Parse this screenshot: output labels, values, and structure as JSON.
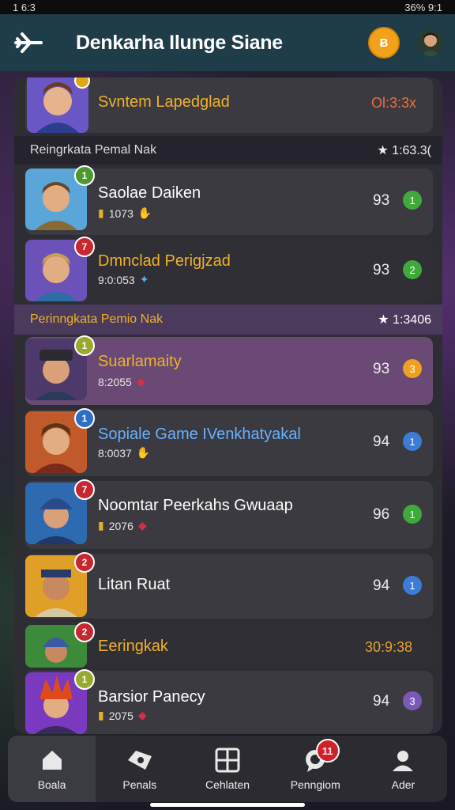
{
  "status": {
    "left": "1 6:3",
    "right": "36% 9:1"
  },
  "header": {
    "title": "Denkarha Ilunge Siane",
    "coin_label": "Ƀ"
  },
  "top_row": {
    "name": "Svntem Lapedglad",
    "time": "Ol:3:3x"
  },
  "section1": {
    "label": "Reingrkata Pemal Nak",
    "value": "★ 1:63.3("
  },
  "section2": {
    "label": "Perinngkata Pemio Nak",
    "value": "★ 1:3406"
  },
  "rows": [
    {
      "name": "Saolae Daiken",
      "sub": "1073",
      "score": "93",
      "rank": "1",
      "rank_color": "#3fa93a",
      "badge": "1",
      "badge_color": "#4a9a2e",
      "name_color": "#ffffff"
    },
    {
      "name": "Dmnclad Perigjzad",
      "sub": "9:0:053",
      "score": "93",
      "rank": "2",
      "rank_color": "#3fa93a",
      "badge": "7",
      "badge_color": "#c7282f",
      "name_color": "#f0b12a"
    },
    {
      "name": "Suarlamaity",
      "sub": "8:2055",
      "score": "93",
      "rank": "3",
      "rank_color": "#f0a020",
      "badge": "1",
      "badge_color": "#9aa92e",
      "name_color": "#f0b12a"
    },
    {
      "name": "Sopiale Game IVenkhatyakal",
      "sub": "8:0037",
      "score": "94",
      "rank": "1",
      "rank_color": "#3c7bd8",
      "badge": "1",
      "badge_color": "#2e6ec7",
      "name_color": "#66b2ff"
    },
    {
      "name": "Noomtar Peerkahs Gwuaap",
      "sub": "2076",
      "score": "96",
      "rank": "1",
      "rank_color": "#3fa93a",
      "badge": "7",
      "badge_color": "#c7282f",
      "name_color": "#ffffff"
    },
    {
      "name": "Litan Ruat",
      "sub": "",
      "score": "94",
      "rank": "1",
      "rank_color": "#3c7bd8",
      "badge": "2",
      "badge_color": "#c7282f",
      "name_color": "#ffffff"
    }
  ],
  "row_eringkak": {
    "name": "Eeringkak",
    "time": "30:9:38",
    "badge": "2"
  },
  "row_last": {
    "name": "Barsior Panecy",
    "sub": "2075",
    "score": "94",
    "rank": "3",
    "badge": "1"
  },
  "tabs": [
    {
      "label": "Boala"
    },
    {
      "label": "Penals"
    },
    {
      "label": "Cehlaten"
    },
    {
      "label": "Penngiom",
      "badge": "11"
    },
    {
      "label": "Ader"
    }
  ],
  "colors": {
    "header_bg": "#1f3c49",
    "accent_gold": "#f0b12a",
    "coin": "#f2a21a"
  }
}
